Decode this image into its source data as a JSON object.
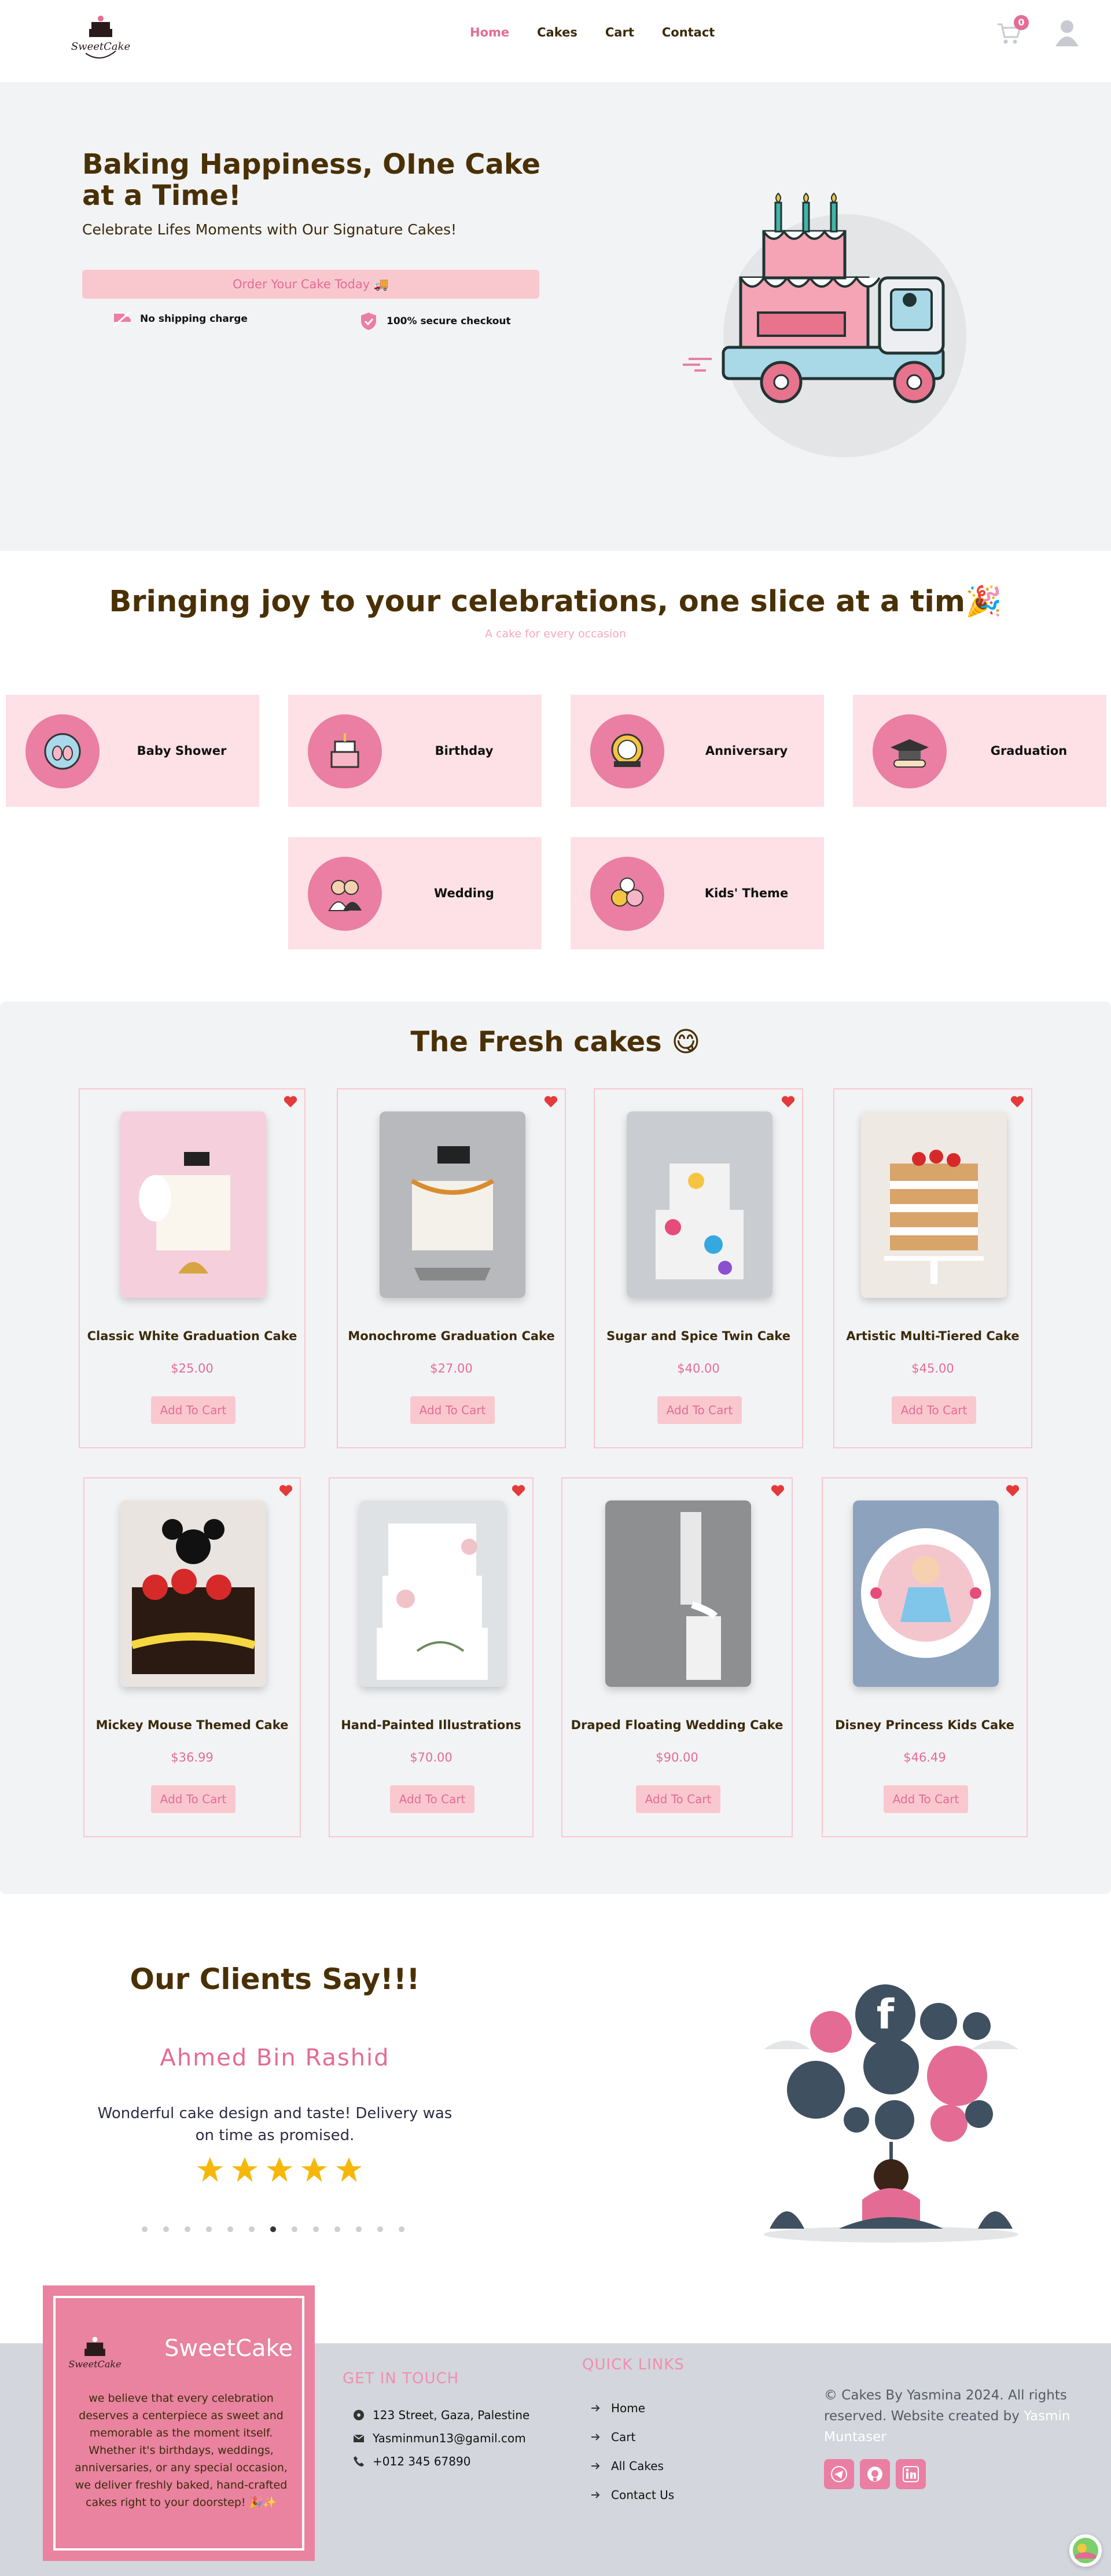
{
  "header": {
    "logo_text": "SweetCake",
    "nav": [
      "Home",
      "Cakes",
      "Cart",
      "Contact"
    ],
    "cart_count": "0"
  },
  "hero": {
    "title": "Baking Happiness, OIne Cake at a Time!",
    "subtitle": "Celebrate Lifes Moments with Our Signature Cakes!",
    "cta": "Order Your Cake Today 🚚",
    "perks": [
      "No shipping charge",
      "100% secure checkout"
    ]
  },
  "occasions": {
    "title": "Bringing joy to your celebrations, one slice at a tim🎉",
    "subtitle": "A cake for every occasion",
    "items": [
      "Baby Shower",
      "Birthday",
      "Anniversary",
      "Graduation",
      "Wedding",
      "Kids' Theme"
    ]
  },
  "cakes": {
    "title": "The Fresh cakes 😋",
    "add_label": "Add To Cart",
    "items": [
      {
        "name": "Classic White Graduation Cake",
        "price": "$25.00"
      },
      {
        "name": "Monochrome Graduation Cake",
        "price": "$27.00"
      },
      {
        "name": "Sugar and Spice Twin Cake",
        "price": "$40.00"
      },
      {
        "name": "Artistic Multi-Tiered Cake",
        "price": "$45.00"
      },
      {
        "name": "Mickey Mouse Themed Cake",
        "price": "$36.99"
      },
      {
        "name": "Hand-Painted Illustrations",
        "price": "$70.00"
      },
      {
        "name": "Draped Floating Wedding Cake",
        "price": "$90.00"
      },
      {
        "name": "Disney Princess Kids Cake",
        "price": "$46.49"
      }
    ]
  },
  "testimonials": {
    "title": "Our Clients Say!!!",
    "name": "Ahmed Bin Rashid",
    "quote": "Wonderful cake design and taste! Delivery was on time as promised.",
    "rating": 5,
    "dots_count": 13,
    "active_dot": 6
  },
  "footer": {
    "about_title": "SweetCake",
    "about_text": "we believe that every celebration deserves a centerpiece as sweet and memorable as the moment itself. Whether it's birthdays, weddings, anniversaries, or any special occasion, we deliver freshly baked, hand-crafted cakes right to your doorstep! 🎉✨",
    "contact_title": "GET IN TOUCH",
    "contact": [
      "123 Street, Gaza, Palestine",
      "Yasminmun13@gamil.com",
      "+012 345 67890"
    ],
    "links_title": "QUICK LINKS",
    "links": [
      "Home",
      "Cart",
      "All Cakes",
      "Contact Us"
    ],
    "copyright": "© Cakes By Yasmina 2024. All rights reserved. Website created by",
    "author": "Yasmin Muntaser"
  },
  "colors": {
    "accent": "#e46c94",
    "heading": "#4a3005",
    "card_pink": "#fde1e6",
    "button_pink": "#f9c8cf",
    "section_bg": "#f2f3f5",
    "footer_bg": "#d3d6dc"
  }
}
